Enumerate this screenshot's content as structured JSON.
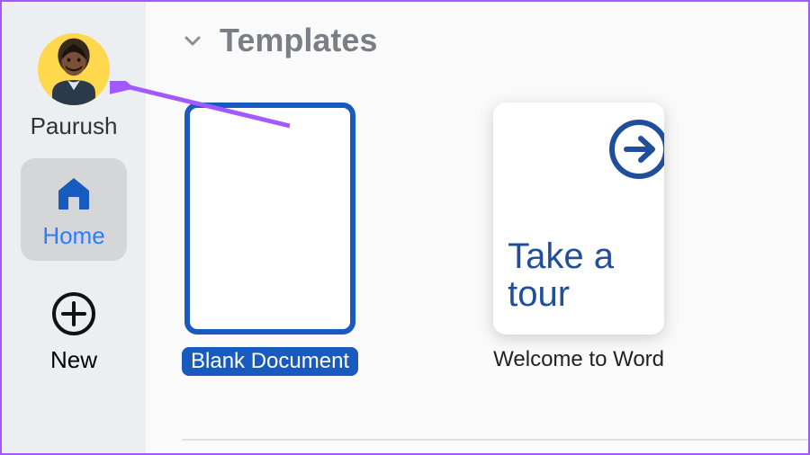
{
  "user": {
    "name": "Paurush"
  },
  "sidebar": {
    "items": [
      {
        "label": "Home"
      },
      {
        "label": "New"
      }
    ]
  },
  "section": {
    "title": "Templates"
  },
  "templates": [
    {
      "label": "Blank Document",
      "selected": true
    },
    {
      "label": "Welcome to Word",
      "selected": false,
      "tour_text": "Take a tour"
    }
  ],
  "colors": {
    "accent": "#185abd",
    "accent_light": "#2b7cff",
    "annotation": "#a259ff"
  }
}
